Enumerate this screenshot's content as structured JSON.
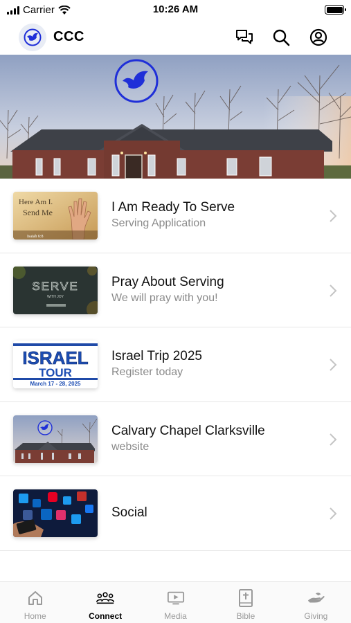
{
  "status_bar": {
    "carrier": "Carrier",
    "time": "10:26 AM"
  },
  "nav": {
    "title": "CCC"
  },
  "list": [
    {
      "title": "I Am Ready To Serve",
      "subtitle": "Serving Application",
      "thumb_text": [
        "Here Am I.",
        "Send Me",
        "Isaiah 6:8"
      ]
    },
    {
      "title": "Pray About Serving",
      "subtitle": "We will pray with you!",
      "thumb_text": [
        "SERVE",
        "WITH JOY"
      ]
    },
    {
      "title": "Israel Trip 2025",
      "subtitle": "Register today",
      "thumb_text": [
        "ISRAEL",
        "TOUR",
        "March 17 - 28, 2025"
      ]
    },
    {
      "title": "Calvary Chapel Clarksville",
      "subtitle": "website"
    },
    {
      "title": "Social"
    }
  ],
  "tabs": [
    {
      "label": "Home",
      "icon": "home-icon"
    },
    {
      "label": "Connect",
      "icon": "people-icon"
    },
    {
      "label": "Media",
      "icon": "video-icon"
    },
    {
      "label": "Bible",
      "icon": "bible-icon"
    },
    {
      "label": "Giving",
      "icon": "giving-icon"
    }
  ],
  "colors": {
    "brand_blue": "#1f2fd8",
    "active_tab": "#000000",
    "inactive_tab": "#9a9a9a",
    "subtitle": "#8a8a8a"
  }
}
